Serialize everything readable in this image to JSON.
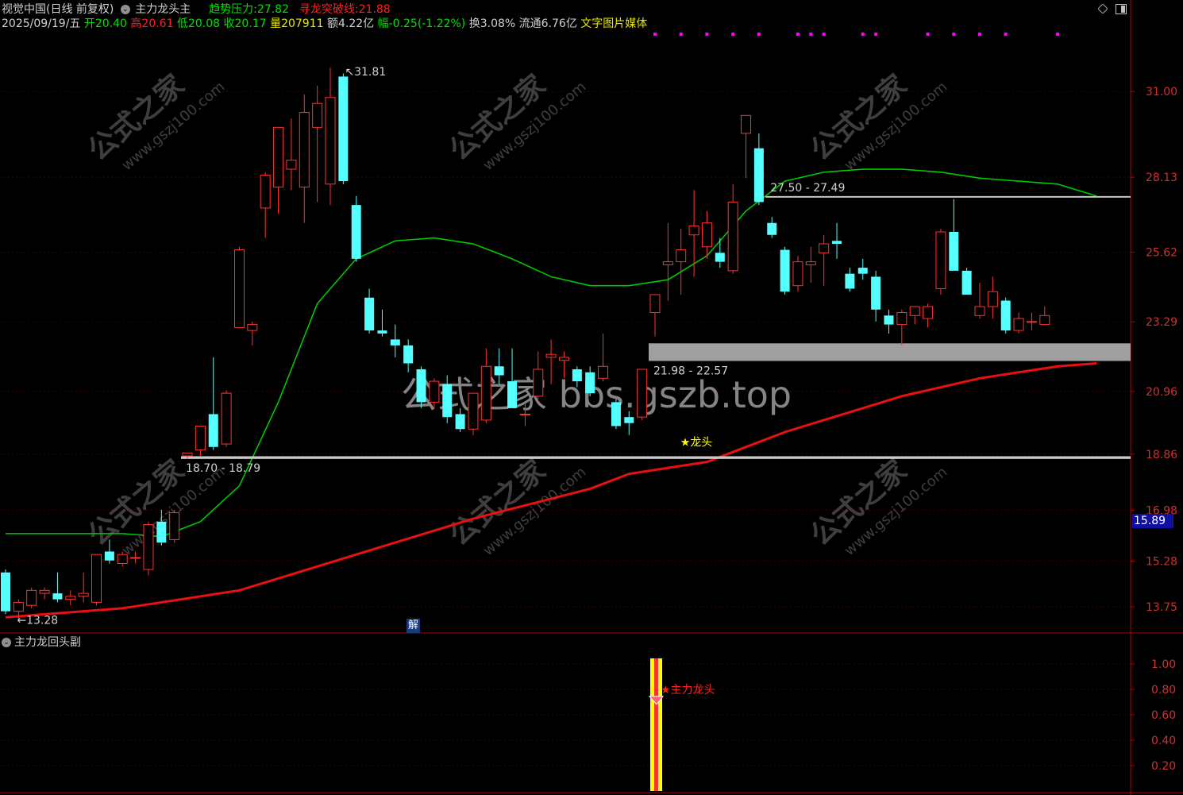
{
  "header": {
    "row1": {
      "stock_name": "视觉中国(日线 前复权)",
      "indicator_name": "主力龙头主",
      "trend_label": "趋势压力:",
      "trend_value": "27.82",
      "breakout_label": "寻龙突破线:",
      "breakout_value": "21.88"
    },
    "row2": {
      "date": "2025/09/19/五",
      "open_label": "开",
      "open": "20.40",
      "high_label": "高",
      "high": "20.61",
      "low_label": "低",
      "low": "20.08",
      "close_label": "收",
      "close": "20.17",
      "volume_label": "量",
      "volume": "207911",
      "amount_label": "额",
      "amount": "4.22亿",
      "change_label": "幅",
      "change": "-0.25(-1.22%)",
      "turnover_label": "换",
      "turnover": "3.08%",
      "float_label": "流通",
      "float": "6.76亿",
      "media": "文字图片媒体"
    }
  },
  "colors": {
    "up": "#ff3232",
    "down": "#54ffff",
    "ma_green": "#00c800",
    "ma_red": "#e81010",
    "axis": "#b40000",
    "grid": "#3c0000",
    "magenta": "#ff00ff",
    "yellow_bar": "#ffff00",
    "gray_band": "#a0a0a0",
    "price_tag_bg": "#1010a0"
  },
  "watermark": {
    "main": "公式之家 bbs.gszb.top",
    "diag_cn": "公式之家",
    "diag_en": "www.gszj100.com"
  },
  "chart_data": [
    {
      "type": "candlestick",
      "panel": "main",
      "y_ticks": [
        31.0,
        28.13,
        25.62,
        23.29,
        20.96,
        18.86,
        16.98,
        15.28,
        13.75
      ],
      "y_tick_labels": [
        "31.00",
        "28.13",
        "25.62",
        "23.29",
        "20.96",
        "18.86",
        "16.98",
        "15.28",
        "13.75"
      ],
      "ylim": [
        12.9,
        33.0
      ],
      "current_price_tag": "15.89",
      "candles": [
        {
          "o": 14.9,
          "h": 15.0,
          "l": 13.5,
          "c": 13.6
        },
        {
          "o": 13.6,
          "h": 14.0,
          "l": 13.3,
          "c": 13.9
        },
        {
          "o": 13.8,
          "h": 14.4,
          "l": 13.7,
          "c": 14.3
        },
        {
          "o": 14.2,
          "h": 14.4,
          "l": 14.0,
          "c": 14.3
        },
        {
          "o": 14.2,
          "h": 14.9,
          "l": 13.9,
          "c": 14.0
        },
        {
          "o": 14.0,
          "h": 14.3,
          "l": 13.8,
          "c": 14.1
        },
        {
          "o": 14.1,
          "h": 14.9,
          "l": 13.9,
          "c": 14.2
        },
        {
          "o": 13.9,
          "h": 15.5,
          "l": 13.8,
          "c": 15.5
        },
        {
          "o": 15.6,
          "h": 16.0,
          "l": 15.2,
          "c": 15.3
        },
        {
          "o": 15.2,
          "h": 15.6,
          "l": 15.1,
          "c": 15.5
        },
        {
          "o": 15.4,
          "h": 15.6,
          "l": 15.2,
          "c": 15.4
        },
        {
          "o": 15.0,
          "h": 16.6,
          "l": 14.8,
          "c": 16.5
        },
        {
          "o": 16.6,
          "h": 17.0,
          "l": 15.8,
          "c": 15.9
        },
        {
          "o": 16.0,
          "h": 17.0,
          "l": 15.9,
          "c": 16.9
        },
        {
          "o": 18.8,
          "h": 18.9,
          "l": 18.7,
          "c": 18.9
        },
        {
          "o": 19.0,
          "h": 19.8,
          "l": 18.8,
          "c": 19.8
        },
        {
          "o": 20.2,
          "h": 22.1,
          "l": 19.0,
          "c": 19.1
        },
        {
          "o": 19.2,
          "h": 21.0,
          "l": 19.1,
          "c": 20.9
        },
        {
          "o": 23.1,
          "h": 25.8,
          "l": 23.1,
          "c": 25.7
        },
        {
          "o": 23.0,
          "h": 23.3,
          "l": 22.5,
          "c": 23.2
        },
        {
          "o": 27.1,
          "h": 28.3,
          "l": 26.1,
          "c": 28.2
        },
        {
          "o": 27.8,
          "h": 29.8,
          "l": 26.9,
          "c": 29.8
        },
        {
          "o": 28.4,
          "h": 30.1,
          "l": 27.7,
          "c": 28.7
        },
        {
          "o": 27.8,
          "h": 30.9,
          "l": 26.6,
          "c": 30.3
        },
        {
          "o": 29.8,
          "h": 31.2,
          "l": 27.3,
          "c": 30.6
        },
        {
          "o": 27.9,
          "h": 31.8,
          "l": 27.2,
          "c": 30.8
        },
        {
          "o": 31.5,
          "h": 31.6,
          "l": 27.9,
          "c": 28.0
        },
        {
          "o": 27.2,
          "h": 27.5,
          "l": 25.3,
          "c": 25.4
        },
        {
          "o": 24.1,
          "h": 24.4,
          "l": 22.9,
          "c": 23.0
        },
        {
          "o": 23.0,
          "h": 23.7,
          "l": 22.8,
          "c": 22.9
        },
        {
          "o": 22.7,
          "h": 23.2,
          "l": 22.1,
          "c": 22.5
        },
        {
          "o": 22.5,
          "h": 22.7,
          "l": 21.6,
          "c": 21.9
        },
        {
          "o": 21.7,
          "h": 21.8,
          "l": 20.4,
          "c": 20.6
        },
        {
          "o": 20.6,
          "h": 21.4,
          "l": 20.4,
          "c": 21.3
        },
        {
          "o": 21.2,
          "h": 21.5,
          "l": 19.9,
          "c": 20.1
        },
        {
          "o": 20.2,
          "h": 20.4,
          "l": 19.6,
          "c": 19.7
        },
        {
          "o": 19.7,
          "h": 20.9,
          "l": 19.5,
          "c": 20.9
        },
        {
          "o": 20.0,
          "h": 22.4,
          "l": 19.9,
          "c": 21.8
        },
        {
          "o": 21.8,
          "h": 22.4,
          "l": 21.2,
          "c": 21.5
        },
        {
          "o": 21.3,
          "h": 22.4,
          "l": 20.4,
          "c": 20.4
        },
        {
          "o": 20.2,
          "h": 20.6,
          "l": 19.8,
          "c": 20.2
        },
        {
          "o": 20.8,
          "h": 22.3,
          "l": 20.7,
          "c": 21.7
        },
        {
          "o": 22.1,
          "h": 22.7,
          "l": 21.2,
          "c": 22.2
        },
        {
          "o": 22.0,
          "h": 22.3,
          "l": 21.4,
          "c": 22.1
        },
        {
          "o": 21.7,
          "h": 21.8,
          "l": 21.1,
          "c": 21.3
        },
        {
          "o": 21.6,
          "h": 21.8,
          "l": 20.8,
          "c": 20.9
        },
        {
          "o": 21.4,
          "h": 22.9,
          "l": 21.3,
          "c": 21.8
        },
        {
          "o": 20.6,
          "h": 20.7,
          "l": 19.7,
          "c": 19.8
        },
        {
          "o": 20.1,
          "h": 20.3,
          "l": 19.5,
          "c": 19.9
        },
        {
          "o": 20.1,
          "h": 21.7,
          "l": 20.0,
          "c": 21.7
        },
        {
          "o": 23.6,
          "h": 24.1,
          "l": 22.8,
          "c": 24.2
        },
        {
          "o": 25.2,
          "h": 26.6,
          "l": 24.0,
          "c": 25.3
        },
        {
          "o": 25.3,
          "h": 26.4,
          "l": 24.2,
          "c": 25.7
        },
        {
          "o": 26.2,
          "h": 27.7,
          "l": 24.8,
          "c": 26.5
        },
        {
          "o": 25.8,
          "h": 27.0,
          "l": 25.4,
          "c": 26.6
        },
        {
          "o": 25.6,
          "h": 26.1,
          "l": 25.1,
          "c": 25.3
        },
        {
          "o": 25.0,
          "h": 27.9,
          "l": 24.9,
          "c": 27.3
        },
        {
          "o": 29.6,
          "h": 29.9,
          "l": 28.1,
          "c": 30.2
        },
        {
          "o": 29.1,
          "h": 29.6,
          "l": 27.2,
          "c": 27.3
        },
        {
          "o": 26.6,
          "h": 26.8,
          "l": 26.1,
          "c": 26.2
        },
        {
          "o": 25.7,
          "h": 25.8,
          "l": 24.2,
          "c": 24.3
        },
        {
          "o": 24.5,
          "h": 25.5,
          "l": 24.3,
          "c": 25.3
        },
        {
          "o": 25.2,
          "h": 25.8,
          "l": 24.6,
          "c": 25.3
        },
        {
          "o": 25.6,
          "h": 26.2,
          "l": 24.5,
          "c": 25.9
        },
        {
          "o": 26.0,
          "h": 26.6,
          "l": 25.4,
          "c": 25.9
        },
        {
          "o": 24.9,
          "h": 25.1,
          "l": 24.3,
          "c": 24.4
        },
        {
          "o": 25.1,
          "h": 25.4,
          "l": 24.7,
          "c": 24.9
        },
        {
          "o": 24.8,
          "h": 25.0,
          "l": 23.3,
          "c": 23.7
        },
        {
          "o": 23.5,
          "h": 23.7,
          "l": 22.9,
          "c": 23.2
        },
        {
          "o": 23.2,
          "h": 23.7,
          "l": 22.5,
          "c": 23.6
        },
        {
          "o": 23.5,
          "h": 23.8,
          "l": 23.2,
          "c": 23.8
        },
        {
          "o": 23.4,
          "h": 23.9,
          "l": 23.1,
          "c": 23.8
        },
        {
          "o": 24.4,
          "h": 26.4,
          "l": 24.2,
          "c": 26.3
        },
        {
          "o": 26.3,
          "h": 27.4,
          "l": 25.8,
          "c": 25.0
        },
        {
          "o": 25.0,
          "h": 25.1,
          "l": 24.2,
          "c": 24.2
        },
        {
          "o": 23.5,
          "h": 24.6,
          "l": 23.4,
          "c": 23.8
        },
        {
          "o": 23.8,
          "h": 24.8,
          "l": 23.4,
          "c": 24.3
        },
        {
          "o": 24.0,
          "h": 24.1,
          "l": 22.9,
          "c": 23.0
        },
        {
          "o": 23.0,
          "h": 23.6,
          "l": 22.9,
          "c": 23.4
        },
        {
          "o": 23.3,
          "h": 23.6,
          "l": 23.0,
          "c": 23.3
        },
        {
          "o": 23.2,
          "h": 23.8,
          "l": 23.2,
          "c": 23.5
        }
      ],
      "lines": [
        {
          "name": "趋势压力",
          "color": "#00c800",
          "x": [
            0,
            9,
            12,
            15,
            18,
            21,
            24,
            27,
            30,
            33,
            36,
            39,
            42,
            45,
            48,
            51,
            54,
            57,
            60,
            63,
            66,
            69,
            72,
            75,
            78,
            81,
            84
          ],
          "values": [
            16.2,
            16.2,
            16.1,
            16.6,
            17.8,
            20.6,
            23.9,
            25.4,
            26.0,
            26.1,
            25.9,
            25.4,
            24.8,
            24.5,
            24.5,
            24.7,
            25.5,
            27.0,
            28.0,
            28.3,
            28.4,
            28.4,
            28.3,
            28.1,
            28.0,
            27.9,
            27.5
          ]
        },
        {
          "name": "寻龙突破线",
          "color": "#e81010",
          "x": [
            0,
            9,
            18,
            27,
            36,
            45,
            48,
            51,
            54,
            57,
            60,
            63,
            66,
            69,
            72,
            75,
            78,
            81,
            84
          ],
          "values": [
            13.4,
            13.7,
            14.3,
            15.5,
            16.7,
            17.7,
            18.2,
            18.4,
            18.6,
            19.1,
            19.6,
            20.0,
            20.4,
            20.8,
            21.1,
            21.4,
            21.6,
            21.8,
            21.9
          ]
        }
      ],
      "support_bands": [
        {
          "label": "18.70 - 18.79",
          "low": 18.7,
          "high": 18.79,
          "from": 14
        },
        {
          "label": "21.98 - 22.57",
          "low": 21.98,
          "high": 22.57,
          "from": 50
        },
        {
          "label": "27.50 - 27.49",
          "low": 27.49,
          "high": 27.5,
          "from": 59
        }
      ],
      "annotations": [
        {
          "text": "31.81",
          "kind": "high"
        },
        {
          "text": "13.28",
          "kind": "low"
        },
        {
          "text": "★龙头",
          "kind": "signal"
        }
      ],
      "magenta_marks": [
        50,
        52,
        54,
        56,
        58,
        61,
        62,
        63,
        66,
        67,
        71,
        73,
        75,
        77,
        81
      ]
    },
    {
      "type": "bar",
      "panel": "sub",
      "title": "主力龙回头副",
      "y_ticks": [
        1.0,
        0.8,
        0.6,
        0.4,
        0.2
      ],
      "y_tick_labels": [
        "1.00",
        "0.80",
        "0.60",
        "0.40",
        "0.20"
      ],
      "ylim": [
        0,
        1.1
      ],
      "signal_candle": 50,
      "signal_value": 1.0,
      "signal_label": "★主力龙头",
      "marker_value": 0.72
    }
  ],
  "misc": {
    "jie_badge": "解"
  }
}
